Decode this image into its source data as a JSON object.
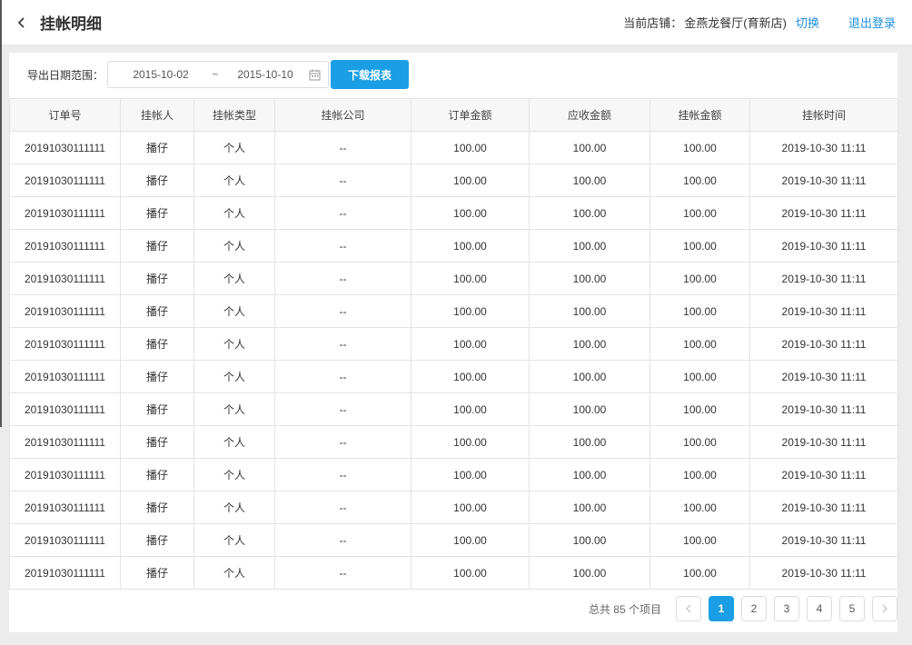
{
  "header": {
    "title": "挂帐明细",
    "back_icon": "chevron-left-icon",
    "store_label": "当前店铺：",
    "store_name": "金燕龙餐厅(育新店)",
    "switch_label": "切换",
    "logout_label": "退出登录"
  },
  "filter": {
    "label": "导出日期范围：",
    "start_date": "2015-10-02",
    "separator": "~",
    "end_date": "2015-10-10",
    "calendar_icon": "calendar-icon",
    "download_label": "下载报表"
  },
  "table": {
    "columns": [
      "订单号",
      "挂帐人",
      "挂帐类型",
      "挂帐公司",
      "订单金额",
      "应收金额",
      "挂帐金额",
      "挂帐时间"
    ],
    "rows": [
      [
        "20191030111111",
        "播仔",
        "个人",
        "--",
        "100.00",
        "100.00",
        "100.00",
        "2019-10-30 11:11"
      ],
      [
        "20191030111111",
        "播仔",
        "个人",
        "--",
        "100.00",
        "100.00",
        "100.00",
        "2019-10-30 11:11"
      ],
      [
        "20191030111111",
        "播仔",
        "个人",
        "--",
        "100.00",
        "100.00",
        "100.00",
        "2019-10-30 11:11"
      ],
      [
        "20191030111111",
        "播仔",
        "个人",
        "--",
        "100.00",
        "100.00",
        "100.00",
        "2019-10-30 11:11"
      ],
      [
        "20191030111111",
        "播仔",
        "个人",
        "--",
        "100.00",
        "100.00",
        "100.00",
        "2019-10-30 11:11"
      ],
      [
        "20191030111111",
        "播仔",
        "个人",
        "--",
        "100.00",
        "100.00",
        "100.00",
        "2019-10-30 11:11"
      ],
      [
        "20191030111111",
        "播仔",
        "个人",
        "--",
        "100.00",
        "100.00",
        "100.00",
        "2019-10-30 11:11"
      ],
      [
        "20191030111111",
        "播仔",
        "个人",
        "--",
        "100.00",
        "100.00",
        "100.00",
        "2019-10-30 11:11"
      ],
      [
        "20191030111111",
        "播仔",
        "个人",
        "--",
        "100.00",
        "100.00",
        "100.00",
        "2019-10-30 11:11"
      ],
      [
        "20191030111111",
        "播仔",
        "个人",
        "--",
        "100.00",
        "100.00",
        "100.00",
        "2019-10-30 11:11"
      ],
      [
        "20191030111111",
        "播仔",
        "个人",
        "--",
        "100.00",
        "100.00",
        "100.00",
        "2019-10-30 11:11"
      ],
      [
        "20191030111111",
        "播仔",
        "个人",
        "--",
        "100.00",
        "100.00",
        "100.00",
        "2019-10-30 11:11"
      ],
      [
        "20191030111111",
        "播仔",
        "个人",
        "--",
        "100.00",
        "100.00",
        "100.00",
        "2019-10-30 11:11"
      ],
      [
        "20191030111111",
        "播仔",
        "个人",
        "--",
        "100.00",
        "100.00",
        "100.00",
        "2019-10-30 11:11"
      ]
    ]
  },
  "pagination": {
    "total_text": "总共 85 个项目",
    "prev_icon": "chevron-left-icon",
    "next_icon": "chevron-right-icon",
    "pages": [
      "1",
      "2",
      "3",
      "4",
      "5"
    ],
    "current_page": "1"
  },
  "colors": {
    "accent": "#1a9ee5",
    "link": "#1a8fe3"
  }
}
